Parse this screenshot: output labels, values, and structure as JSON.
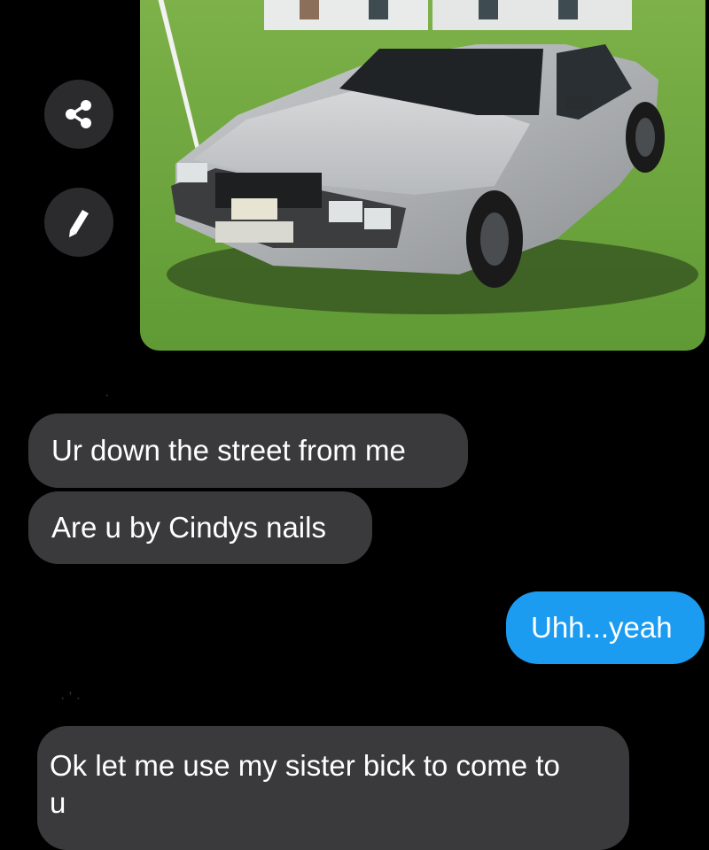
{
  "theme": {
    "background": "#000000",
    "incoming_bubble": "#3a3a3c",
    "outgoing_bubble": "#1b9cf0",
    "text_color": "#ffffff"
  },
  "actions": {
    "share_icon": "share-icon",
    "edit_icon": "pencil-icon"
  },
  "messages": [
    {
      "direction": "incoming",
      "text": "Ur down the street from me"
    },
    {
      "direction": "incoming",
      "text": "Are u by Cindys nails"
    },
    {
      "direction": "outgoing",
      "text": "Uhh...yeah"
    },
    {
      "direction": "incoming",
      "text": "Ok let me use my sister bick to come to u"
    }
  ]
}
